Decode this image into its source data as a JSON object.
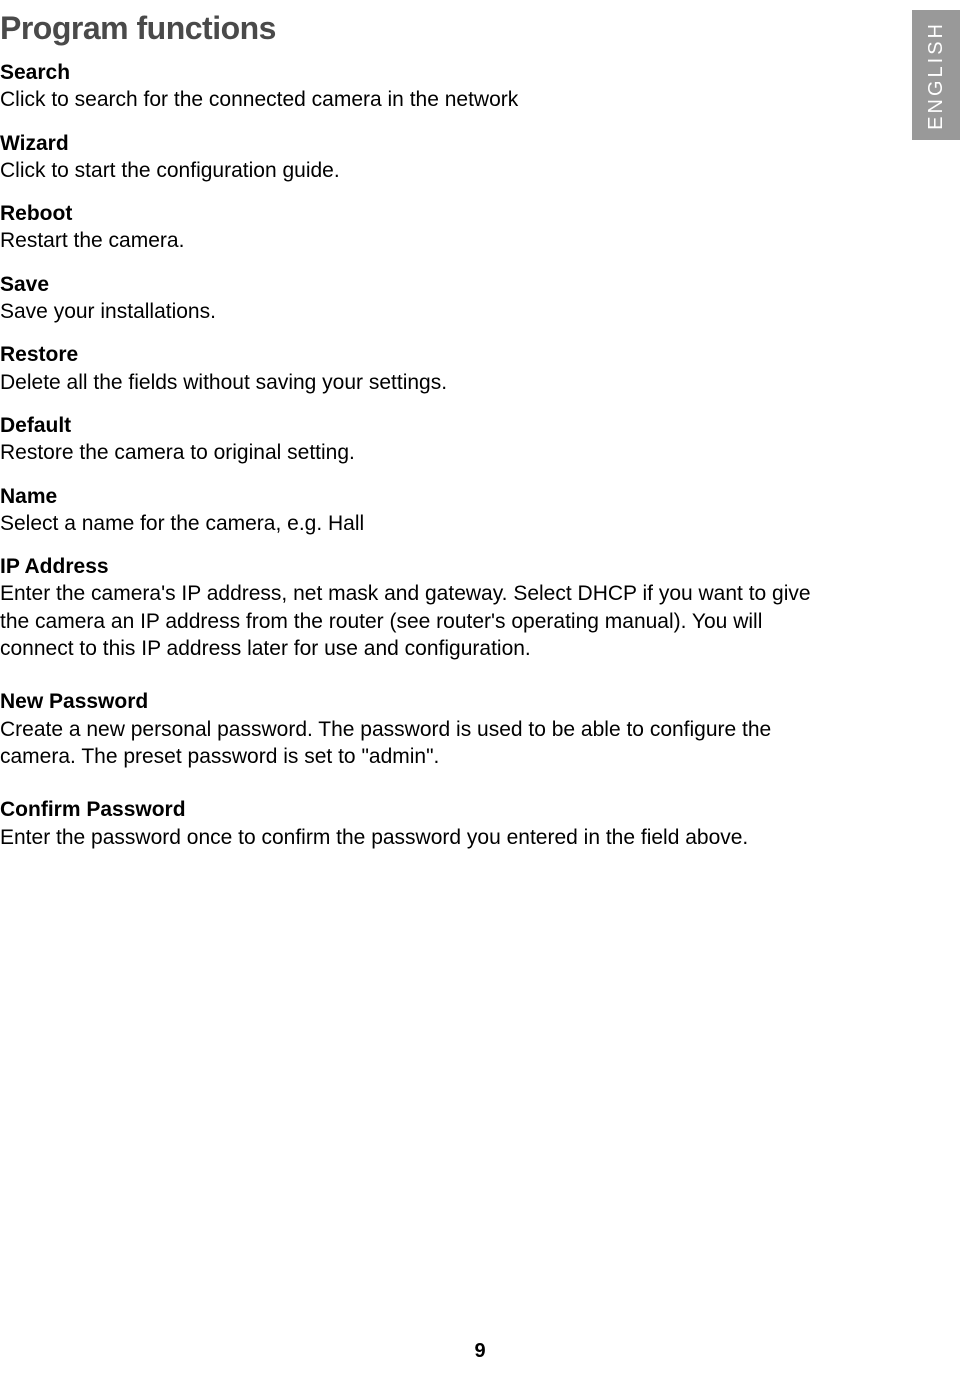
{
  "page": {
    "title": "Program functions",
    "number": "9",
    "language_tab": "ENGLISH"
  },
  "sections": {
    "search": {
      "heading": "Search",
      "body": "Click to search for the connected camera in the network"
    },
    "wizard": {
      "heading": "Wizard",
      "body": "Click to start the configuration guide."
    },
    "reboot": {
      "heading": "Reboot",
      "body": "Restart the camera."
    },
    "save": {
      "heading": "Save",
      "body": "Save your installations."
    },
    "restore": {
      "heading": "Restore",
      "body": "Delete all the fields without saving your settings."
    },
    "default": {
      "heading": "Default",
      "body": "Restore the camera to original setting."
    },
    "name": {
      "heading": "Name",
      "body": "Select a name for the camera, e.g. Hall"
    },
    "ip_address": {
      "heading": "IP Address",
      "body": "Enter the camera's IP address, net mask and gateway. Select DHCP if you want to give the camera an IP address from the router (see router's operating manual). You will connect to this IP address later for use and configuration."
    },
    "new_password": {
      "heading": "New Password",
      "body": "Create a new personal password. The password is used to be able to configure the camera. The preset password is set to \"admin\"."
    },
    "confirm_password": {
      "heading": "Confirm Password",
      "body": "Enter the password once to confirm the password you entered in the field above."
    }
  }
}
